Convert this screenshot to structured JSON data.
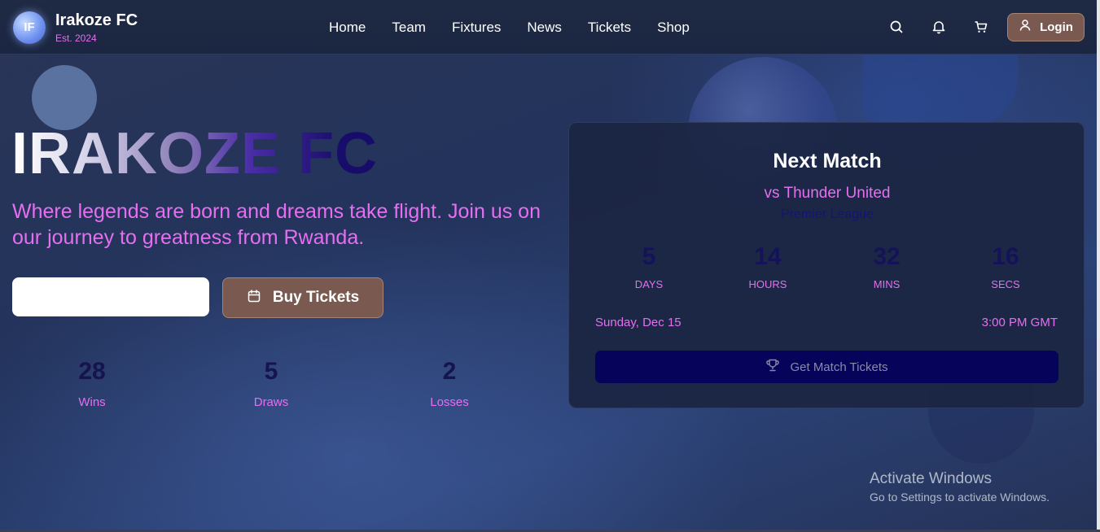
{
  "brand": {
    "logo_initials": "IF",
    "name": "Irakoze FC",
    "established": "Est. 2024"
  },
  "nav": {
    "items": [
      {
        "label": "Home"
      },
      {
        "label": "Team"
      },
      {
        "label": "Fixtures"
      },
      {
        "label": "News"
      },
      {
        "label": "Tickets"
      },
      {
        "label": "Shop"
      }
    ]
  },
  "header_actions": {
    "icons": [
      "search-icon",
      "bell-icon",
      "cart-icon"
    ],
    "login_label": "Login"
  },
  "hero": {
    "title": "IRAKOZE FC",
    "tagline": "Where legends are born and dreams take flight. Join us on our journey to greatness from Rwanda.",
    "input_value": "",
    "buy_label": "Buy Tickets",
    "stats": [
      {
        "value": "28",
        "label": "Wins"
      },
      {
        "value": "5",
        "label": "Draws"
      },
      {
        "value": "2",
        "label": "Losses"
      }
    ]
  },
  "next_match": {
    "title": "Next Match",
    "opponent": "vs Thunder United",
    "league": "Premier League",
    "countdown": [
      {
        "value": "5",
        "label": "DAYS"
      },
      {
        "value": "14",
        "label": "HOURS"
      },
      {
        "value": "32",
        "label": "MINS"
      },
      {
        "value": "16",
        "label": "SECS"
      }
    ],
    "date": "Sunday, Dec 15",
    "time": "3:00 PM GMT",
    "button_label": "Get Match Tickets"
  },
  "watermark": {
    "title": "Activate Windows",
    "subtitle": "Go to Settings to activate Windows."
  },
  "colors": {
    "accent_pink": "#e56ff0",
    "button_brown": "#7a5a50",
    "deep_navy": "#14135a",
    "background": "#23335c"
  }
}
